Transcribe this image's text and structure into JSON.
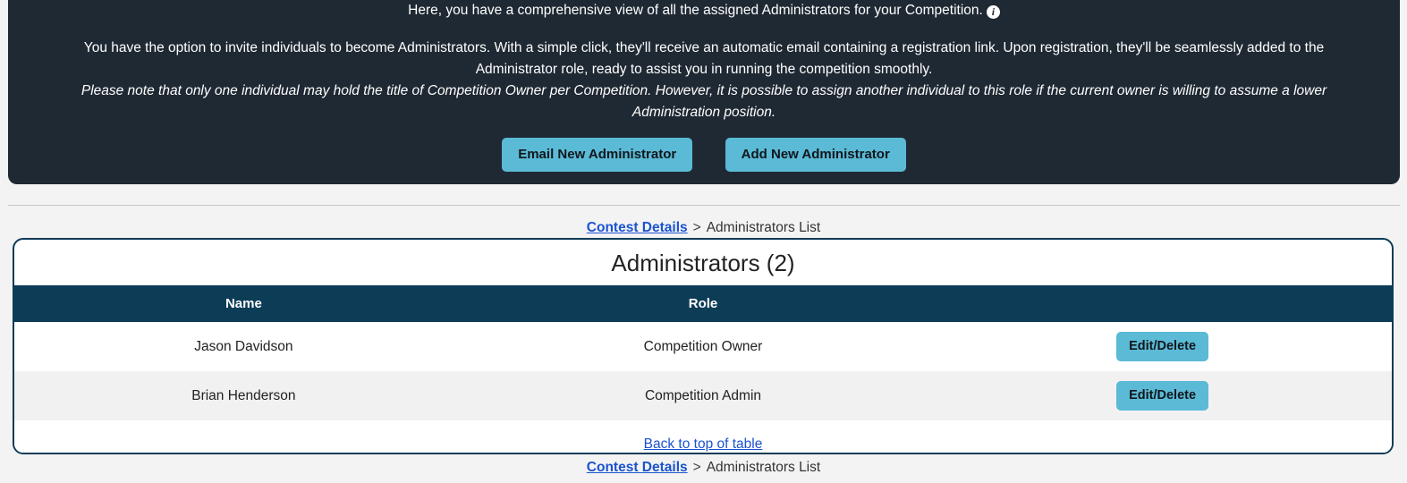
{
  "info_panel": {
    "lead_text": "Here, you have a comprehensive view of all the assigned Administrators for your Competition.",
    "info_icon": "info-icon",
    "body_text": "You have the option to invite individuals to become Administrators. With a simple click, they'll receive an automatic email containing a registration link. Upon registration, they'll be seamlessly added to the Administrator role, ready to assist you in running the competition smoothly.",
    "note_text": "Please note that only one individual may hold the title of Competition Owner per Competition. However, it is possible to assign another individual to this role if the current owner is willing to assume a lower Administration position.",
    "email_admin_button": "Email New Administrator",
    "add_admin_button": "Add New Administrator",
    "background_color": "#1f2933",
    "button_color": "#5bbad5"
  },
  "breadcrumb": {
    "link_label": "Contest Details",
    "separator": ">",
    "current_label": "Administrators List",
    "link_color": "#1a53d0"
  },
  "card": {
    "title": "Administrators (2)",
    "border_color": "#0d3c57",
    "table": {
      "header_background": "#0d3c57",
      "columns": [
        "Name",
        "Role",
        ""
      ],
      "rows": [
        {
          "name": "Jason Davidson",
          "role": "Competition Owner",
          "action": "Edit/Delete"
        },
        {
          "name": "Brian Henderson",
          "role": "Competition Admin",
          "action": "Edit/Delete"
        }
      ]
    },
    "footer_link": "Back to top of table"
  }
}
